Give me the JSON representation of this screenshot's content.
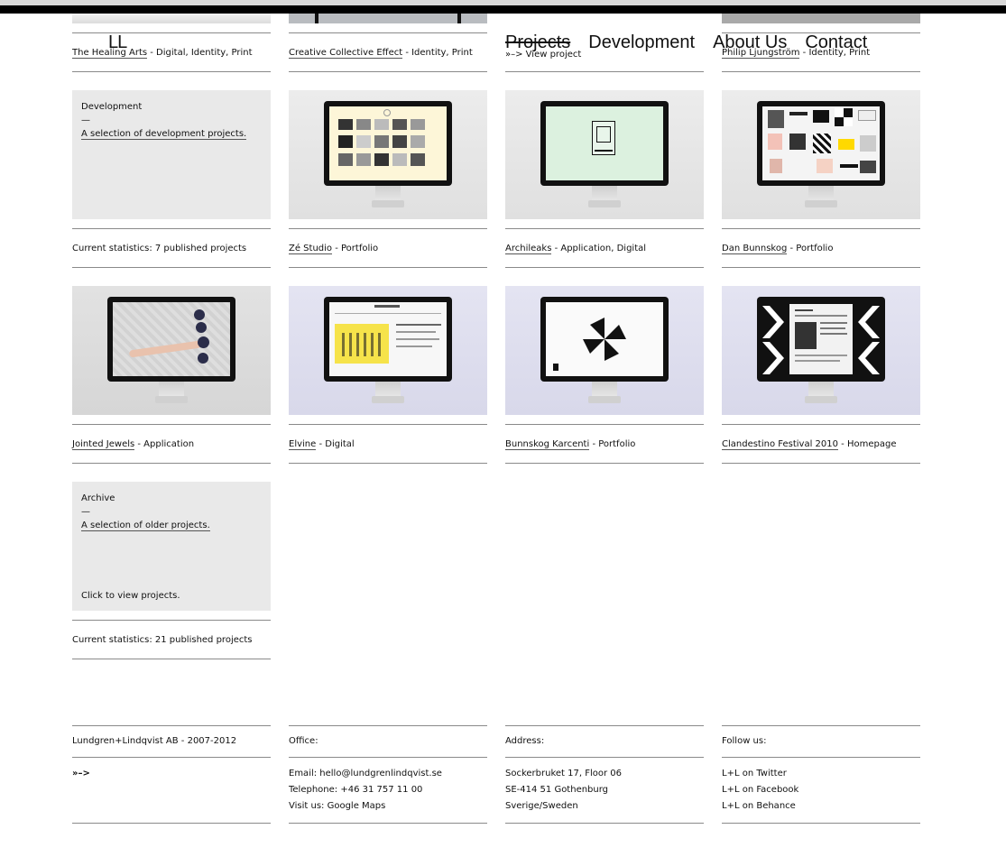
{
  "header": {
    "logo": "LL",
    "nav": [
      "Projects",
      "Development",
      "About Us",
      "Contact"
    ],
    "active": "Projects"
  },
  "row0": [
    {
      "title": "The Healing Arts",
      "tags": " - Digital, Identity, Print"
    },
    {
      "title": "Creative Collective Effect",
      "tags": " - Identity, Print"
    },
    {
      "view": "»–> View project"
    },
    {
      "title": "Philip Ljungström",
      "tags": " - Identity, Print"
    }
  ],
  "development": {
    "heading": "Development",
    "dash": "—",
    "link": "A selection of development projects.",
    "stats": "Current statistics: 7 published projects"
  },
  "row1": [
    {
      "title": "Zé Studio",
      "tags": " - Portfolio"
    },
    {
      "title": "Archileaks",
      "tags": " - Application, Digital"
    },
    {
      "title": "Dan Bunnskog",
      "tags": " - Portfolio"
    }
  ],
  "row2": [
    {
      "title": "Jointed Jewels",
      "tags": " - Application"
    },
    {
      "title": "Elvine",
      "tags": " - Digital"
    },
    {
      "title": "Bunnskog Karcenti",
      "tags": " - Portfolio"
    },
    {
      "title": "Clandestino Festival 2010",
      "tags": " - Homepage"
    }
  ],
  "archive": {
    "heading": "Archive",
    "dash": "—",
    "link": "A selection of older projects.",
    "click": "Click to view projects.",
    "stats": "Current statistics: 21 published projects"
  },
  "footer": {
    "company": "Lundgren+Lindqvist AB - 2007-2012",
    "arrow": "»–>",
    "office_label": "Office:",
    "email": "Email: hello@lundgrenlindqvist.se",
    "phone": "Telephone: +46 31 757 11 00",
    "maps": "Visit us: Google Maps",
    "address_label": "Address:",
    "addr1": "Sockerbruket 17, Floor 06",
    "addr2": "SE-414 51 Gothenburg",
    "addr3": "Sverige/Sweden",
    "follow_label": "Follow us:",
    "twitter": "L+L on Twitter",
    "facebook": "L+L on Facebook",
    "behance": "L+L on Behance"
  }
}
